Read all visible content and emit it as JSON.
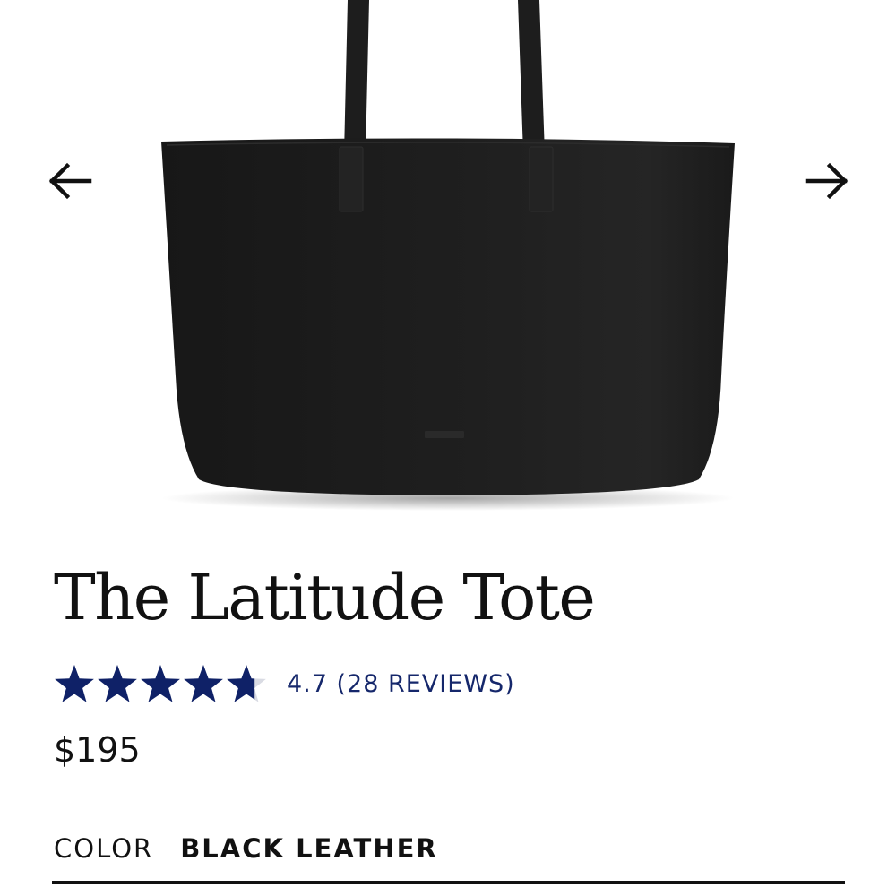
{
  "product": {
    "title": "The Latitude Tote",
    "rating": {
      "value": 4.7,
      "max": 5,
      "text": "4.7 (28 REVIEWS)"
    },
    "price": "$195",
    "color": {
      "label": "COLOR",
      "value": "BLACK LEATHER"
    }
  },
  "carousel": {
    "prev_icon": "arrow-left-icon",
    "next_icon": "arrow-right-icon"
  },
  "colors": {
    "star": "#0f2167",
    "star_empty": "#d9dbe3",
    "rating_text": "#15276b",
    "bag": "#1c1c1c",
    "text": "#111111"
  }
}
